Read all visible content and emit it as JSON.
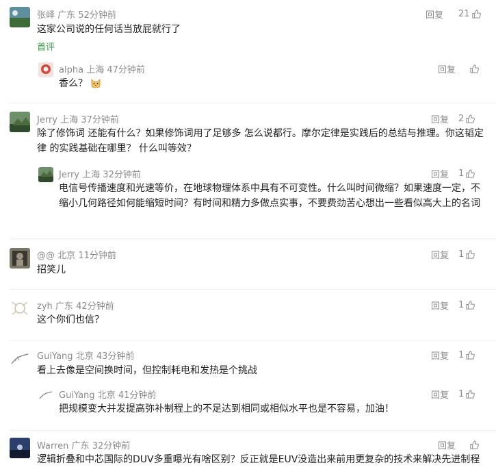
{
  "labels": {
    "reply": "回复",
    "first_comment": "首评"
  },
  "comments": [
    {
      "user": "张峄",
      "location": "广东",
      "time": "52分钟前",
      "likes": "21",
      "text": "这家公司说的任何话当放屁就行了",
      "replies": [
        {
          "user": "alpha",
          "location": "上海",
          "time": "47分钟前",
          "likes": "",
          "text": "香么？"
        }
      ]
    },
    {
      "user": "Jerry",
      "location": "上海",
      "time": "37分钟前",
      "likes": "2",
      "text": "除了修饰词 还能有什么？如果修饰词用了足够多 怎么说都行。摩尔定律是实践后的总结与推理。你这韬定律 的实践基础在哪里？ 什么叫等效？",
      "replies": [
        {
          "user": "Jerry",
          "location": "上海",
          "time": "32分钟前",
          "likes": "1",
          "text": "电信号传播速度和光速等价，在地球物理体系中具有不可变性。什么叫时间微缩？如果速度一定，不缩小几何路径如何能缩短时间？有时间和精力多做点实事，不要费劲苦心想出一些看似高大上的名词"
        }
      ]
    },
    {
      "user": "@@",
      "location": "北京",
      "time": "11分钟前",
      "likes": "1",
      "text": "招笑儿",
      "replies": []
    },
    {
      "user": "zyh",
      "location": "广东",
      "time": "42分钟前",
      "likes": "1",
      "text": "这个你们也信？",
      "replies": []
    },
    {
      "user": "GuiYang",
      "location": "北京",
      "time": "43分钟前",
      "likes": "1",
      "text": "看上去像是空间换时间，但控制耗电和发热是个挑战",
      "replies": [
        {
          "user": "GuiYang",
          "location": "北京",
          "time": "41分钟前",
          "likes": "1",
          "text": "把规模变大并发提高弥补制程上的不足达到相同或相似水平也是不容易，加油！"
        }
      ]
    },
    {
      "user": "Warren",
      "location": "广东",
      "time": "32分钟前",
      "likes": "",
      "text": "逻辑折叠和中芯国际的DUV多重曝光有啥区别？反正就是EUV没造出来前用更复杂的技术来解决先进制程",
      "replies": []
    }
  ],
  "icons": {
    "like": "thumbs-up-icon",
    "reply_emoji": "cat-emoji-icon"
  },
  "colors": {
    "meta": "#8a8a8a",
    "first_tag": "#3aa34a",
    "text": "#222222"
  }
}
